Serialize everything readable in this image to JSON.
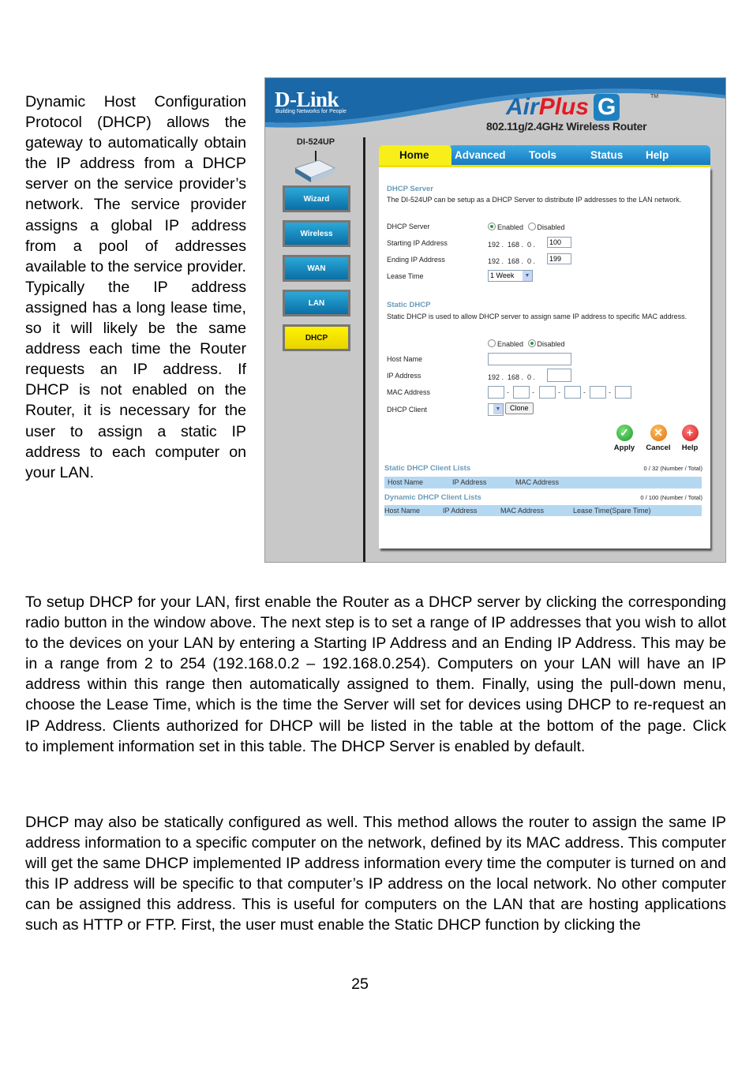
{
  "intro_text": "Dynamic Host Configuration Protocol (DHCP) allows the gateway to automatically obtain the IP address from a DHCP server on the service provider’s network. The service provider assigns a global IP address from a pool of addresses available to the service provider. Typically the IP address assigned has a long lease time, so it will likely be the same address each time the Router requests an IP address. If DHCP is not enabled on the Router, it is necessary for the user to assign a static IP address to each computer on your LAN.",
  "paragraph1": "To setup DHCP for your LAN, first enable the Router as a DHCP server by clicking the corresponding                  radio button in the window above. The next step is to set a range of IP addresses that you wish to allot to the devices on your LAN by entering a Starting IP Address and an Ending IP Address. This may be in a range from 2 to 254 (192.168.0.2 – 192.168.0.254). Computers on your LAN will have an IP address within this range then automatically assigned to them. Finally, using the pull-down menu, choose the Lease Time, which is the time the Server will set for devices using DHCP to re-request an IP Address. Clients authorized for DHCP will be listed in the table at the bottom of the page. Click             to implement information set in this table. The DHCP Server is enabled by default.",
  "paragraph2": "DHCP may also be statically configured as well. This method allows the router to assign the same IP address information to a specific computer on the network, defined by its MAC address. This computer will get the same DHCP implemented IP address information every time the computer is turned on and this IP address will be specific to that computer’s IP address on the local network. No other computer can be assigned this address. This is useful for computers on the LAN that are hosting applications such as HTTP or FTP. First, the user must enable the Static DHCP function by clicking the",
  "page_number": "25",
  "router_ui": {
    "brand": "D-Link",
    "brand_tagline": "Building Networks for People",
    "product_air": "Air",
    "product_plus": "Plus",
    "product_g": "G",
    "trademark": "TM",
    "product_subtitle": "802.11g/2.4GHz Wireless Router",
    "model": "DI-524UP",
    "sidebar": [
      "Wizard",
      "Wireless",
      "WAN",
      "LAN",
      "DHCP"
    ],
    "sidebar_active": "DHCP",
    "tabs": [
      "Home",
      "Advanced",
      "Tools",
      "Status",
      "Help"
    ],
    "active_tab": "Home",
    "dhcp_server": {
      "title": "DHCP Server",
      "description": "The DI-524UP can be setup as a DHCP Server to distribute IP addresses to the LAN network.",
      "server_label": "DHCP Server",
      "enabled_label": "Enabled",
      "disabled_label": "Disabled",
      "selected": "Enabled",
      "start_label": "Starting IP Address",
      "start_prefix": "192 .  168 .  0 .",
      "start_value": "100",
      "end_label": "Ending IP Address",
      "end_prefix": "192 .  168 .  0 .",
      "end_value": "199",
      "lease_label": "Lease Time",
      "lease_value": "1 Week"
    },
    "static_dhcp": {
      "title": "Static DHCP",
      "description": "Static DHCP is used to allow DHCP server to assign same IP address to specific MAC address.",
      "enabled_label": "Enabled",
      "disabled_label": "Disabled",
      "selected": "Disabled",
      "host_label": "Host Name",
      "host_value": "",
      "ip_label": "IP Address",
      "ip_prefix": "192 .  168 .  0 .",
      "ip_value": "",
      "mac_label": "MAC Address",
      "mac_values": [
        "",
        "",
        "",
        "",
        "",
        ""
      ],
      "client_label": "DHCP Client",
      "client_value": "",
      "clone_label": "Clone"
    },
    "actions": {
      "apply": "Apply",
      "cancel": "Cancel",
      "help": "Help"
    },
    "static_list": {
      "title": "Static DHCP Client Lists",
      "count": "0 / 32 (Number / Total)",
      "columns": [
        "Host Name",
        "IP Address",
        "MAC Address"
      ]
    },
    "dynamic_list": {
      "title": "Dynamic DHCP Client Lists",
      "count": "0 / 100 (Number / Total)",
      "columns": [
        "Host Name",
        "IP Address",
        "MAC Address",
        "Lease Time(Spare Time)"
      ]
    }
  }
}
